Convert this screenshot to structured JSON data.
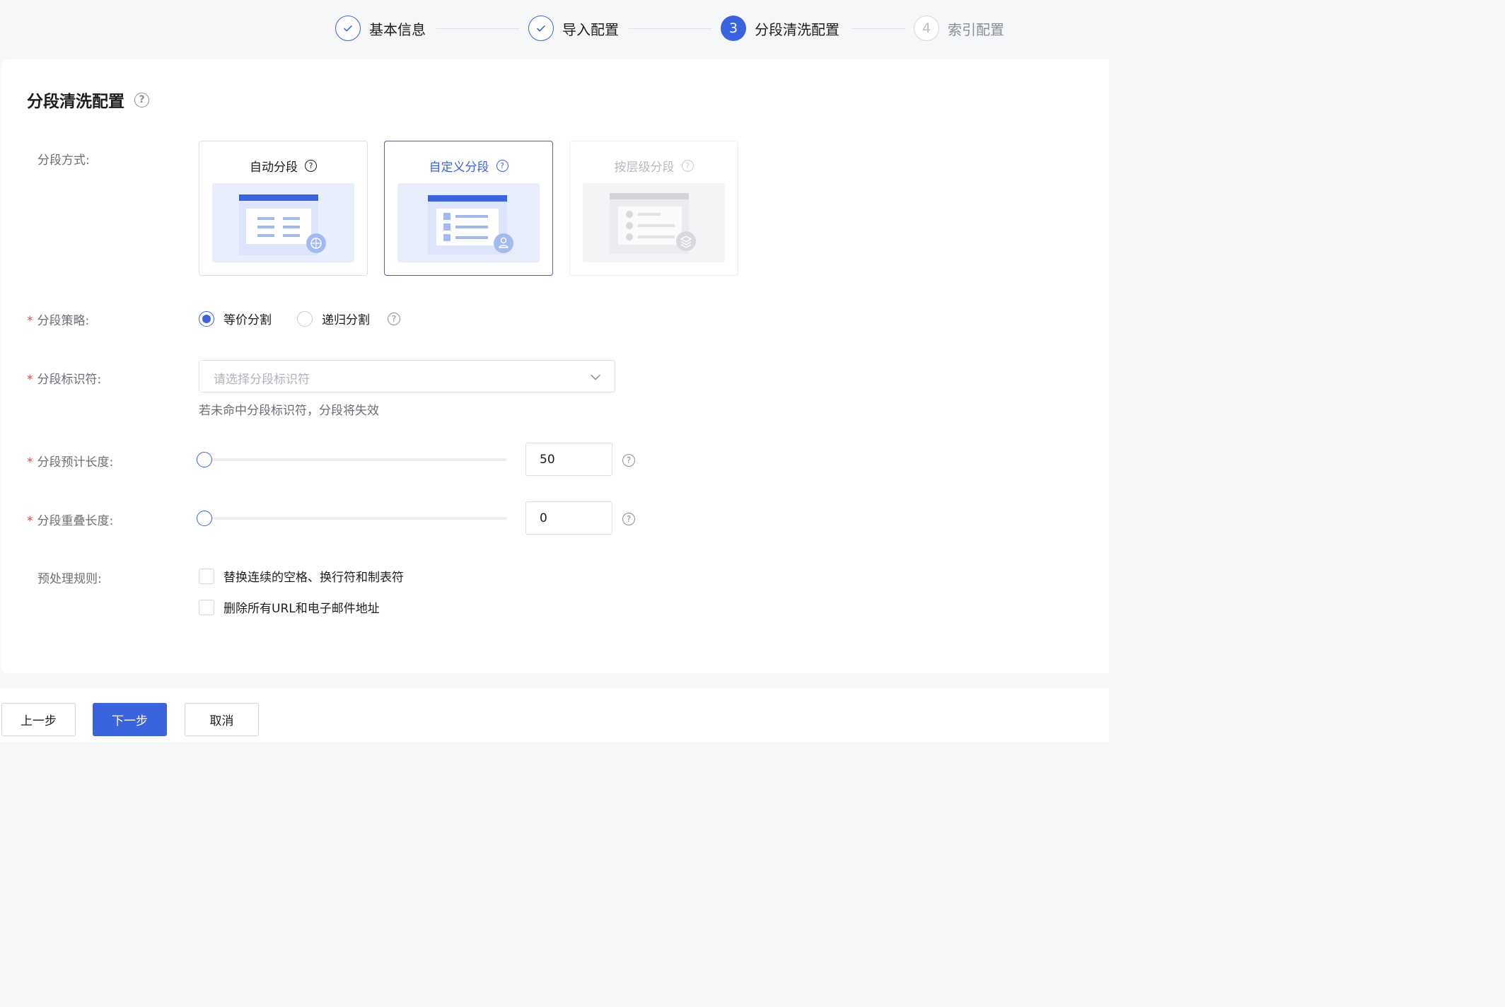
{
  "steps": [
    {
      "label": "基本信息",
      "status": "done"
    },
    {
      "label": "导入配置",
      "status": "done"
    },
    {
      "number": "3",
      "label": "分段清洗配置",
      "status": "active"
    },
    {
      "number": "4",
      "label": "索引配置",
      "status": "pending"
    }
  ],
  "section": {
    "title": "分段清洗配置"
  },
  "segment_mode": {
    "label": "分段方式:",
    "options": [
      {
        "title": "自动分段",
        "state": "normal"
      },
      {
        "title": "自定义分段",
        "state": "selected"
      },
      {
        "title": "按层级分段",
        "state": "disabled"
      }
    ]
  },
  "strategy": {
    "label": "分段策略:",
    "options": [
      "等价分割",
      "递归分割"
    ],
    "selected": "等价分割"
  },
  "identifier": {
    "label": "分段标识符:",
    "placeholder": "请选择分段标识符",
    "hint": "若未命中分段标识符，分段将失效"
  },
  "est_length": {
    "label": "分段预计长度:",
    "value": "50"
  },
  "overlap_length": {
    "label": "分段重叠长度:",
    "value": "0"
  },
  "preprocess": {
    "label": "预处理规则:",
    "rules": [
      {
        "label": "替换连续的空格、换行符和制表符",
        "checked": false
      },
      {
        "label": "删除所有URL和电子邮件地址",
        "checked": false
      }
    ]
  },
  "footer": {
    "prev": "上一步",
    "next": "下一步",
    "cancel": "取消"
  },
  "colors": {
    "primary": "#3a63e0",
    "required": "#e34d4d"
  }
}
